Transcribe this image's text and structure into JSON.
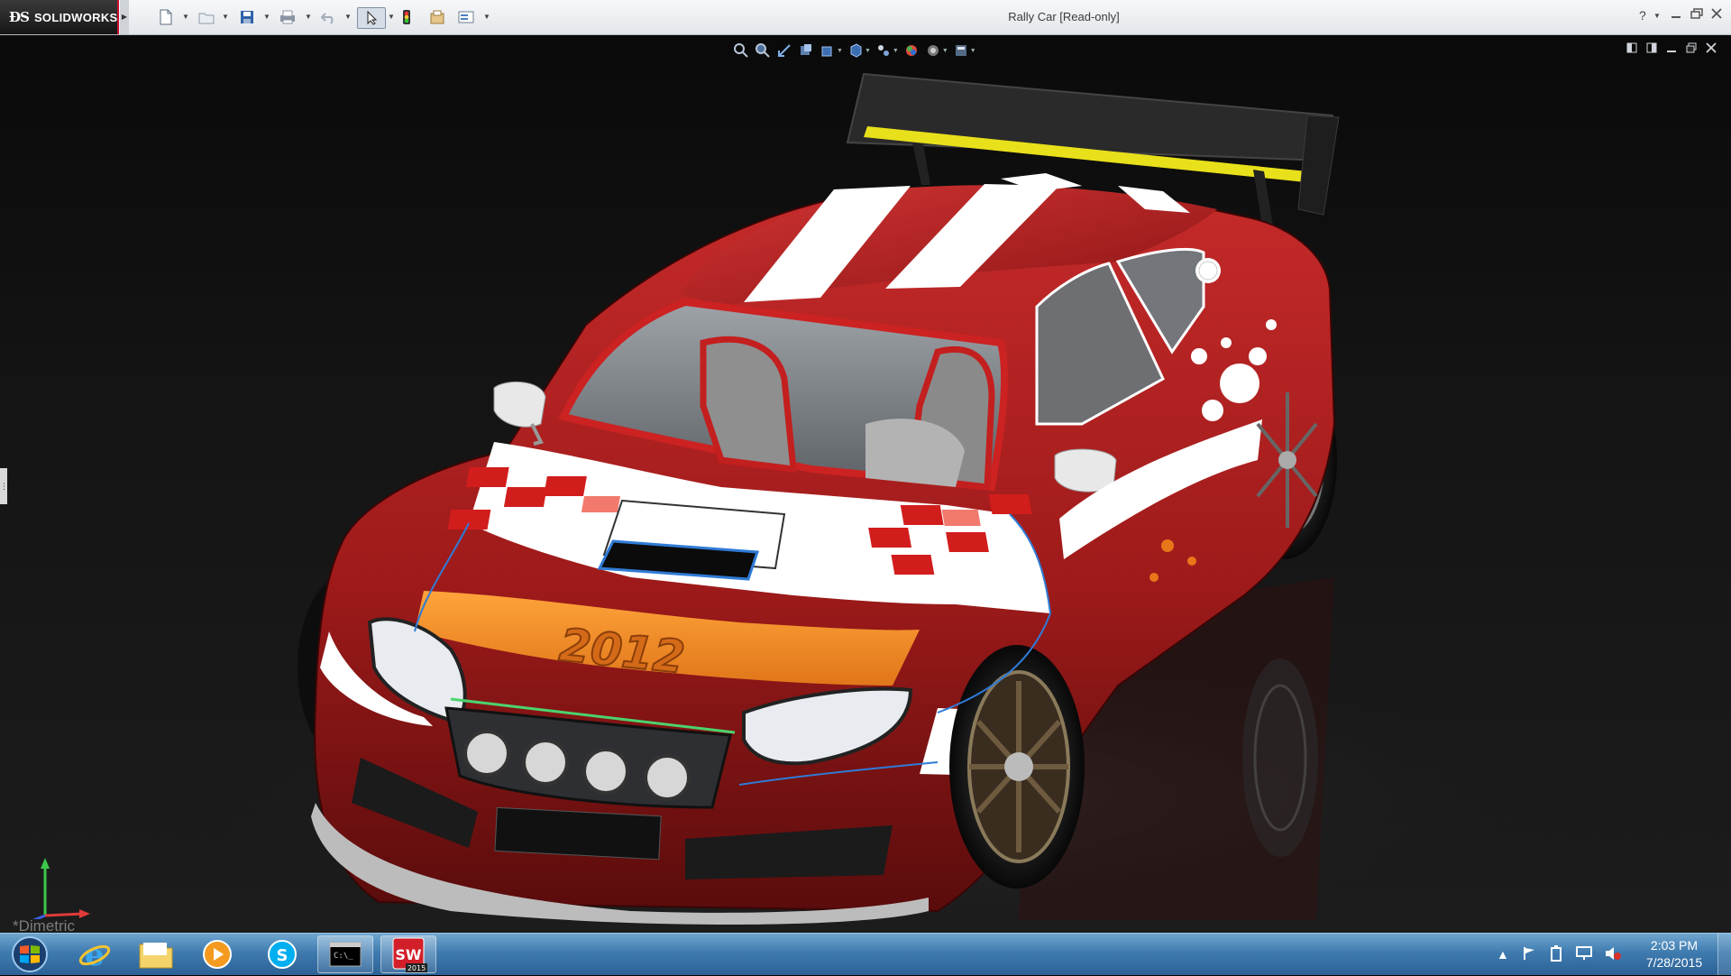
{
  "app": {
    "brand": "SOLIDWORKS",
    "window_title": "Rally Car [Read-only]"
  },
  "toolbar": {
    "items": [
      "new-file-icon",
      "open-file-icon",
      "save-icon",
      "print-icon",
      "undo-icon",
      "select-icon",
      "rebuild-icon",
      "file-properties-icon",
      "options-icon"
    ],
    "help_symbol": "?"
  },
  "heads_up_toolbar": {
    "items": [
      "zoom-to-fit-icon",
      "zoom-to-area-icon",
      "previous-view-icon",
      "section-view-icon",
      "view-orientation-icon",
      "display-style-icon",
      "hide-show-items-icon",
      "edit-appearance-icon",
      "apply-scene-icon",
      "view-settings-icon"
    ]
  },
  "viewport": {
    "view_label": "*Dimetric",
    "model": "Rally car",
    "hood_number": "2012",
    "colors": {
      "body": "#9e1a1a",
      "stripe": "#ffffff",
      "hood_band": "#f08a1c",
      "wing_accent": "#e8e01a",
      "background": "#111111"
    }
  },
  "taskbar": {
    "apps": [
      "start-orb",
      "internet-explorer",
      "windows-explorer",
      "media-player",
      "skype",
      "command-prompt",
      "solidworks-2015"
    ],
    "solidworks_badge": "2015",
    "clock_time": "2:03 PM",
    "clock_date": "7/28/2015"
  }
}
